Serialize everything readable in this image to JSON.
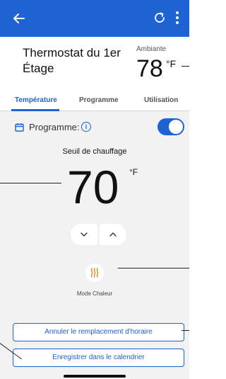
{
  "header": {
    "title": "Thermostat du 1er Étage",
    "ambient_label": "Ambiante",
    "ambient_value": "78",
    "ambient_unit": "°F"
  },
  "tabs": [
    {
      "label": "Température",
      "active": true
    },
    {
      "label": "Programme",
      "active": false
    },
    {
      "label": "Utilisation",
      "active": false
    }
  ],
  "schedule": {
    "label": "Programme:",
    "info_glyph": "i",
    "toggle_on": true
  },
  "setpoint": {
    "label": "Seuil de chauffage",
    "value": "70",
    "unit": "°F"
  },
  "mode": {
    "label": "Mode Chaleur",
    "icon": "heat-waves-icon",
    "icon_color": "#e0872a"
  },
  "actions": {
    "cancel_label": "Annuler le remplacement d'horaire",
    "save_label": "Enregistrer dans le calendrier"
  },
  "colors": {
    "accent": "#1f62d4",
    "panel_bg": "#f2f2f2"
  }
}
